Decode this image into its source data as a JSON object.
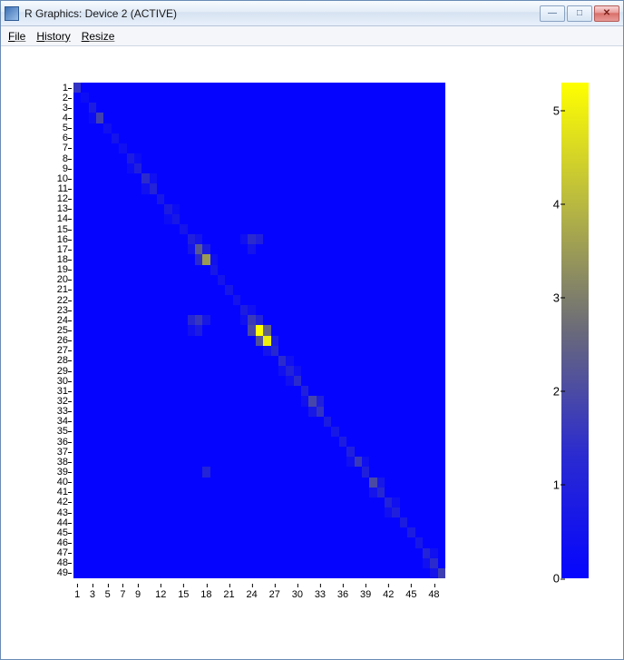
{
  "window": {
    "title": "R Graphics: Device 2 (ACTIVE)"
  },
  "menu": {
    "file": "File",
    "history": "History",
    "resize": "Resize"
  },
  "chart_data": {
    "type": "heatmap",
    "n_rows": 49,
    "n_cols": 49,
    "xlabel": "",
    "ylabel": "",
    "x_categories": [
      1,
      2,
      3,
      4,
      5,
      6,
      7,
      8,
      9,
      10,
      11,
      12,
      13,
      14,
      15,
      16,
      17,
      18,
      19,
      20,
      21,
      22,
      23,
      24,
      25,
      26,
      27,
      28,
      29,
      30,
      31,
      32,
      33,
      34,
      35,
      36,
      37,
      38,
      39,
      40,
      41,
      42,
      43,
      44,
      45,
      46,
      47,
      48,
      49
    ],
    "y_categories": [
      1,
      2,
      3,
      4,
      5,
      6,
      7,
      8,
      9,
      10,
      11,
      12,
      13,
      14,
      15,
      16,
      17,
      18,
      19,
      20,
      21,
      22,
      23,
      24,
      25,
      26,
      27,
      28,
      29,
      30,
      31,
      32,
      33,
      34,
      35,
      36,
      37,
      38,
      39,
      40,
      41,
      42,
      43,
      44,
      45,
      46,
      47,
      48,
      49
    ],
    "x_tick_labels": [
      1,
      3,
      5,
      7,
      9,
      12,
      15,
      18,
      21,
      24,
      27,
      30,
      33,
      36,
      39,
      42,
      45,
      48
    ],
    "y_tick_labels": [
      1,
      2,
      3,
      4,
      5,
      6,
      7,
      8,
      9,
      10,
      11,
      12,
      13,
      14,
      15,
      16,
      17,
      18,
      19,
      20,
      21,
      22,
      23,
      24,
      25,
      26,
      27,
      28,
      29,
      30,
      31,
      32,
      33,
      34,
      35,
      36,
      37,
      38,
      39,
      40,
      41,
      42,
      43,
      44,
      45,
      46,
      47,
      48,
      49
    ],
    "legend": {
      "min": 0,
      "max": 5.3,
      "ticks": [
        0,
        1,
        2,
        3,
        4,
        5
      ],
      "colormap": "blue-gray-yellow"
    },
    "background_value": 0,
    "nonzero_cells": [
      {
        "r": 1,
        "c": 1,
        "v": 1.2
      },
      {
        "r": 2,
        "c": 2,
        "v": 0.2
      },
      {
        "r": 3,
        "c": 3,
        "v": 0.6
      },
      {
        "r": 4,
        "c": 4,
        "v": 1.6
      },
      {
        "r": 4,
        "c": 3,
        "v": 0.2
      },
      {
        "r": 5,
        "c": 5,
        "v": 0.3
      },
      {
        "r": 6,
        "c": 6,
        "v": 0.4
      },
      {
        "r": 7,
        "c": 7,
        "v": 0.3
      },
      {
        "r": 8,
        "c": 8,
        "v": 0.6
      },
      {
        "r": 8,
        "c": 9,
        "v": 0.2
      },
      {
        "r": 9,
        "c": 9,
        "v": 0.7
      },
      {
        "r": 9,
        "c": 8,
        "v": 0.2
      },
      {
        "r": 10,
        "c": 10,
        "v": 1.0
      },
      {
        "r": 10,
        "c": 11,
        "v": 0.3
      },
      {
        "r": 11,
        "c": 11,
        "v": 0.8
      },
      {
        "r": 11,
        "c": 10,
        "v": 0.3
      },
      {
        "r": 12,
        "c": 12,
        "v": 0.5
      },
      {
        "r": 13,
        "c": 13,
        "v": 0.6
      },
      {
        "r": 13,
        "c": 14,
        "v": 0.2
      },
      {
        "r": 14,
        "c": 14,
        "v": 0.5
      },
      {
        "r": 14,
        "c": 13,
        "v": 0.2
      },
      {
        "r": 15,
        "c": 15,
        "v": 0.4
      },
      {
        "r": 16,
        "c": 16,
        "v": 0.7
      },
      {
        "r": 16,
        "c": 17,
        "v": 0.4
      },
      {
        "r": 16,
        "c": 24,
        "v": 1.0
      },
      {
        "r": 16,
        "c": 25,
        "v": 0.7
      },
      {
        "r": 16,
        "c": 23,
        "v": 0.3
      },
      {
        "r": 17,
        "c": 17,
        "v": 2.2
      },
      {
        "r": 17,
        "c": 16,
        "v": 0.4
      },
      {
        "r": 17,
        "c": 18,
        "v": 0.6
      },
      {
        "r": 17,
        "c": 24,
        "v": 0.4
      },
      {
        "r": 18,
        "c": 18,
        "v": 3.5
      },
      {
        "r": 18,
        "c": 17,
        "v": 1.0
      },
      {
        "r": 18,
        "c": 19,
        "v": 0.3
      },
      {
        "r": 19,
        "c": 19,
        "v": 0.5
      },
      {
        "r": 20,
        "c": 20,
        "v": 0.4
      },
      {
        "r": 21,
        "c": 21,
        "v": 0.5
      },
      {
        "r": 22,
        "c": 22,
        "v": 0.4
      },
      {
        "r": 23,
        "c": 23,
        "v": 0.6
      },
      {
        "r": 23,
        "c": 24,
        "v": 0.3
      },
      {
        "r": 24,
        "c": 24,
        "v": 1.4
      },
      {
        "r": 24,
        "c": 23,
        "v": 0.3
      },
      {
        "r": 24,
        "c": 16,
        "v": 0.9
      },
      {
        "r": 24,
        "c": 17,
        "v": 1.3
      },
      {
        "r": 24,
        "c": 18,
        "v": 0.5
      },
      {
        "r": 24,
        "c": 25,
        "v": 0.8
      },
      {
        "r": 25,
        "c": 25,
        "v": 5.3
      },
      {
        "r": 25,
        "c": 24,
        "v": 1.8
      },
      {
        "r": 25,
        "c": 26,
        "v": 2.5
      },
      {
        "r": 25,
        "c": 16,
        "v": 0.3
      },
      {
        "r": 25,
        "c": 17,
        "v": 0.6
      },
      {
        "r": 26,
        "c": 26,
        "v": 5.0
      },
      {
        "r": 26,
        "c": 25,
        "v": 2.0
      },
      {
        "r": 26,
        "c": 27,
        "v": 0.6
      },
      {
        "r": 27,
        "c": 27,
        "v": 0.9
      },
      {
        "r": 27,
        "c": 26,
        "v": 0.4
      },
      {
        "r": 28,
        "c": 28,
        "v": 1.0
      },
      {
        "r": 28,
        "c": 29,
        "v": 0.3
      },
      {
        "r": 29,
        "c": 29,
        "v": 0.8
      },
      {
        "r": 29,
        "c": 28,
        "v": 0.3
      },
      {
        "r": 29,
        "c": 30,
        "v": 0.3
      },
      {
        "r": 30,
        "c": 30,
        "v": 1.0
      },
      {
        "r": 30,
        "c": 29,
        "v": 0.3
      },
      {
        "r": 31,
        "c": 31,
        "v": 0.7
      },
      {
        "r": 32,
        "c": 32,
        "v": 1.7
      },
      {
        "r": 32,
        "c": 33,
        "v": 0.7
      },
      {
        "r": 32,
        "c": 31,
        "v": 0.3
      },
      {
        "r": 33,
        "c": 33,
        "v": 1.2
      },
      {
        "r": 33,
        "c": 32,
        "v": 0.5
      },
      {
        "r": 34,
        "c": 34,
        "v": 0.6
      },
      {
        "r": 35,
        "c": 35,
        "v": 0.5
      },
      {
        "r": 36,
        "c": 36,
        "v": 0.6
      },
      {
        "r": 37,
        "c": 37,
        "v": 0.7
      },
      {
        "r": 38,
        "c": 38,
        "v": 1.4
      },
      {
        "r": 38,
        "c": 37,
        "v": 0.3
      },
      {
        "r": 38,
        "c": 39,
        "v": 0.3
      },
      {
        "r": 39,
        "c": 39,
        "v": 0.7
      },
      {
        "r": 40,
        "c": 40,
        "v": 1.8
      },
      {
        "r": 40,
        "c": 41,
        "v": 0.5
      },
      {
        "r": 39,
        "c": 18,
        "v": 0.8
      },
      {
        "r": 41,
        "c": 41,
        "v": 0.9
      },
      {
        "r": 41,
        "c": 40,
        "v": 0.4
      },
      {
        "r": 42,
        "c": 42,
        "v": 0.8
      },
      {
        "r": 42,
        "c": 43,
        "v": 0.3
      },
      {
        "r": 43,
        "c": 43,
        "v": 0.7
      },
      {
        "r": 43,
        "c": 42,
        "v": 0.3
      },
      {
        "r": 44,
        "c": 44,
        "v": 0.6
      },
      {
        "r": 45,
        "c": 45,
        "v": 0.6
      },
      {
        "r": 46,
        "c": 46,
        "v": 0.5
      },
      {
        "r": 47,
        "c": 47,
        "v": 0.8
      },
      {
        "r": 47,
        "c": 48,
        "v": 0.3
      },
      {
        "r": 48,
        "c": 48,
        "v": 1.0
      },
      {
        "r": 48,
        "c": 47,
        "v": 0.3
      },
      {
        "r": 49,
        "c": 49,
        "v": 1.5
      },
      {
        "r": 49,
        "c": 48,
        "v": 0.4
      }
    ]
  }
}
